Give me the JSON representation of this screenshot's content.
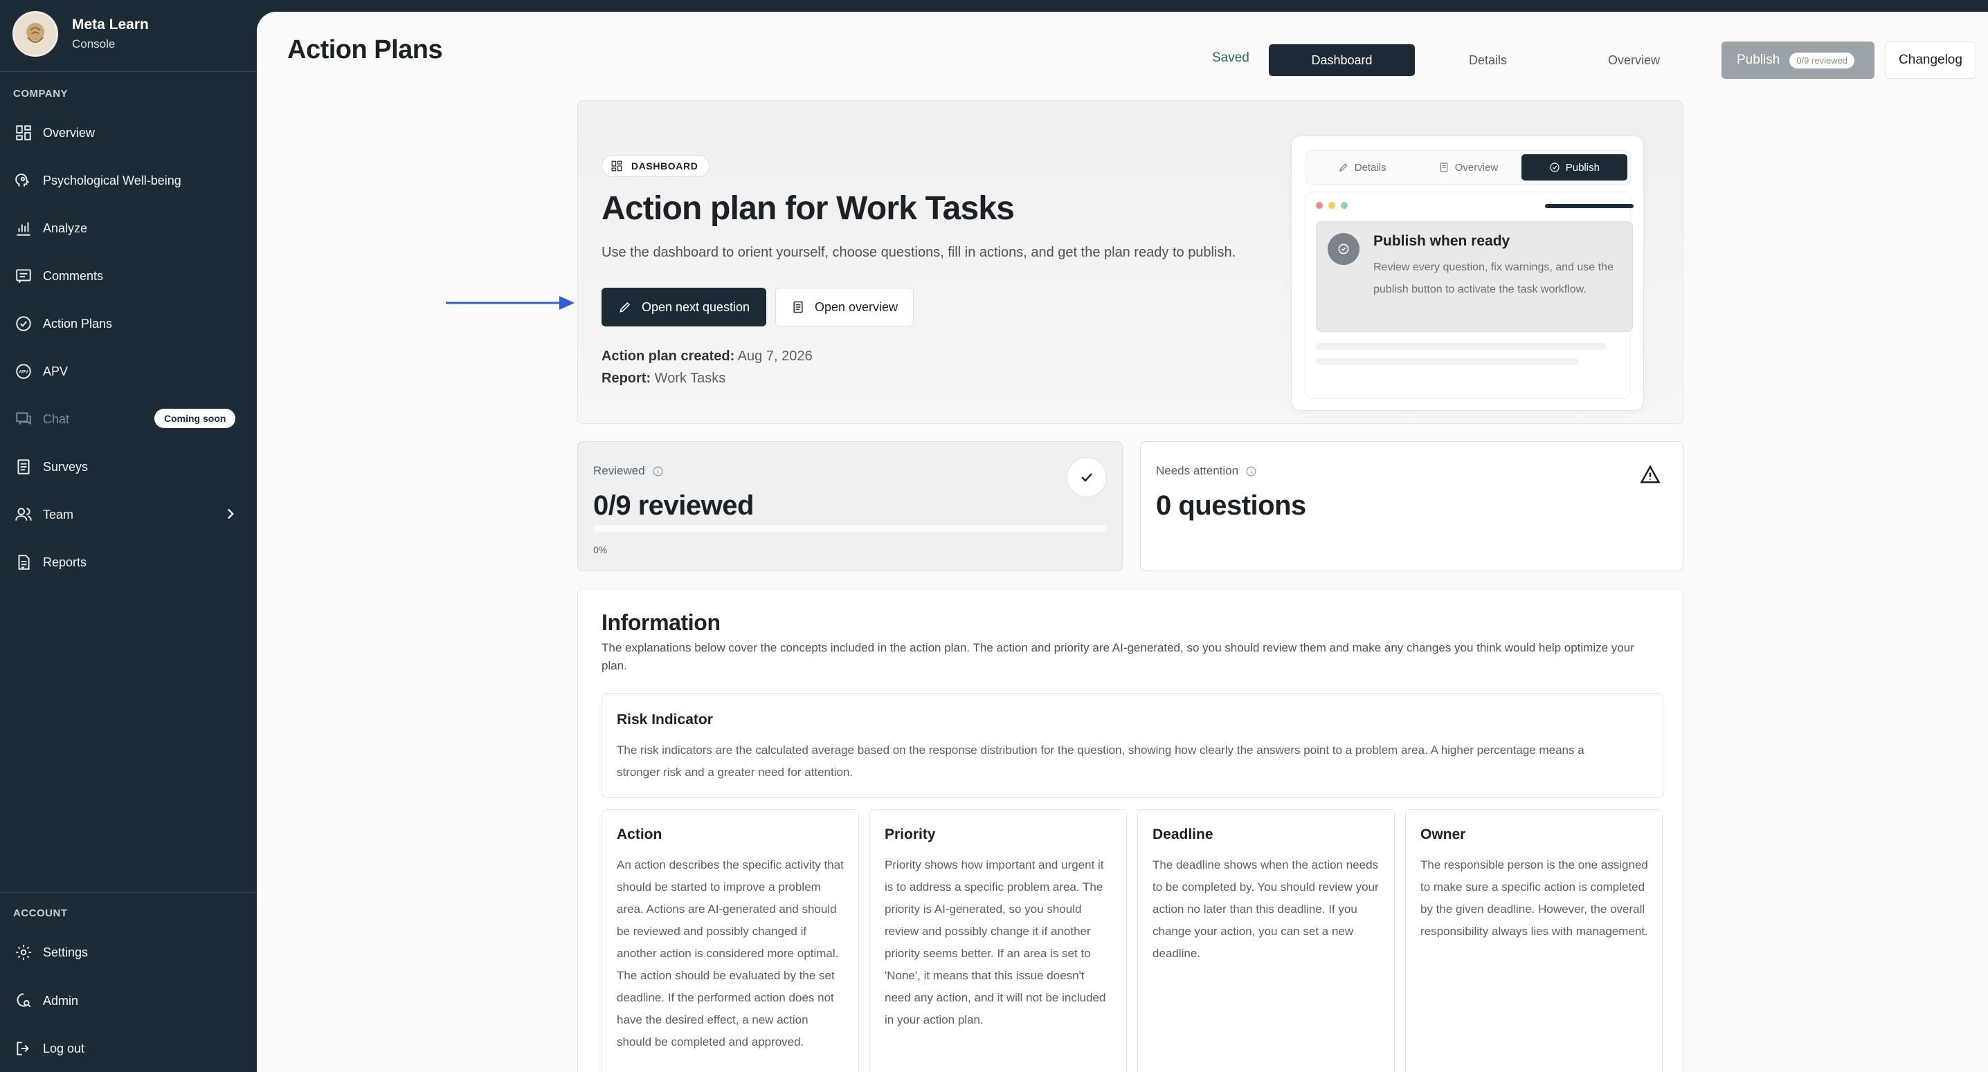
{
  "sidebar": {
    "brand": {
      "name": "Meta Learn",
      "subtitle": "Console"
    },
    "company_label": "COMPANY",
    "items": [
      {
        "label": "Overview",
        "icon": "grid-icon"
      },
      {
        "label": "Psychological Well-being",
        "icon": "head-icon"
      },
      {
        "label": "Analyze",
        "icon": "bar-chart-icon"
      },
      {
        "label": "Comments",
        "icon": "comment-icon"
      },
      {
        "label": "Action Plans",
        "icon": "check-circle-icon"
      },
      {
        "label": "APV",
        "icon": "apv-icon"
      },
      {
        "label": "Chat",
        "icon": "chat-icon",
        "badge": "Coming soon"
      },
      {
        "label": "Surveys",
        "icon": "clipboard-icon"
      },
      {
        "label": "Team",
        "icon": "team-icon"
      },
      {
        "label": "Reports",
        "icon": "report-icon"
      }
    ],
    "account_label": "ACCOUNT",
    "account_items": [
      {
        "label": "Settings",
        "icon": "gear-icon"
      },
      {
        "label": "Admin",
        "icon": "admin-icon"
      },
      {
        "label": "Log out",
        "icon": "logout-icon"
      }
    ]
  },
  "header": {
    "title": "Action Plans",
    "saved_status": "Saved",
    "tabs": [
      "Dashboard",
      "Details",
      "Overview"
    ],
    "active_tab": "Dashboard",
    "publish_label": "Publish",
    "publish_badge": "0/9 reviewed",
    "changelog_label": "Changelog"
  },
  "hero": {
    "chip": "DASHBOARD",
    "title": "Action plan for Work Tasks",
    "subtitle": "Use the dashboard to orient yourself, choose questions, fill in actions, and get the plan ready to publish.",
    "primary_button": "Open next question",
    "secondary_button": "Open overview",
    "created_label": "Action plan created:",
    "created_value": "Aug 7, 2026",
    "report_label": "Report:",
    "report_value": "Work Tasks"
  },
  "preview": {
    "tabs": [
      "Details",
      "Overview",
      "Publish"
    ],
    "active_tab": "Publish",
    "card_title": "Publish when ready",
    "card_body": "Review every question, fix warnings, and use the publish button to activate the task workflow."
  },
  "stats": {
    "reviewed": {
      "label": "Reviewed",
      "value": "0/9 reviewed",
      "progress_text": "0%",
      "progress": 0
    },
    "attention": {
      "label": "Needs attention",
      "value": "0 questions"
    }
  },
  "information": {
    "title": "Information",
    "description": "The explanations below cover the concepts included in the action plan. The action and priority are AI-generated, so you should review them and make any changes you think would help optimize your plan.",
    "risk": {
      "title": "Risk Indicator",
      "body": "The risk indicators are the calculated average based on the response distribution for the question, showing how clearly the answers point to a problem area. A higher percentage means a stronger risk and a greater need for attention."
    },
    "columns": [
      {
        "title": "Action",
        "body": "An action describes the specific activity that should be started to improve a problem area. Actions are AI-generated and should be reviewed and possibly changed if another action is considered more optimal. The action should be evaluated by the set deadline. If the performed action does not have the desired effect, a new action should be completed and approved."
      },
      {
        "title": "Priority",
        "body": "Priority shows how important and urgent it is to address a specific problem area. The priority is AI-generated, so you should review and possibly change it if another priority seems better. If an area is set to 'None', it means that this issue doesn't need any action, and it will not be included in your action plan."
      },
      {
        "title": "Deadline",
        "body": "The deadline shows when the action needs to be completed by. You should review your action no later than this deadline. If you change your action, you can set a new deadline."
      },
      {
        "title": "Owner",
        "body": "The responsible person is the one assigned to make sure a specific action is completed by the given deadline. However, the overall responsibility always lies with management."
      }
    ]
  },
  "colors": {
    "sidebar_bg": "#1c2b36",
    "accent_dark": "#1c2b36",
    "saved_green": "#2c6e49",
    "arrow_blue": "#2f5fd0",
    "publish_disabled": "#9ba3a8"
  }
}
